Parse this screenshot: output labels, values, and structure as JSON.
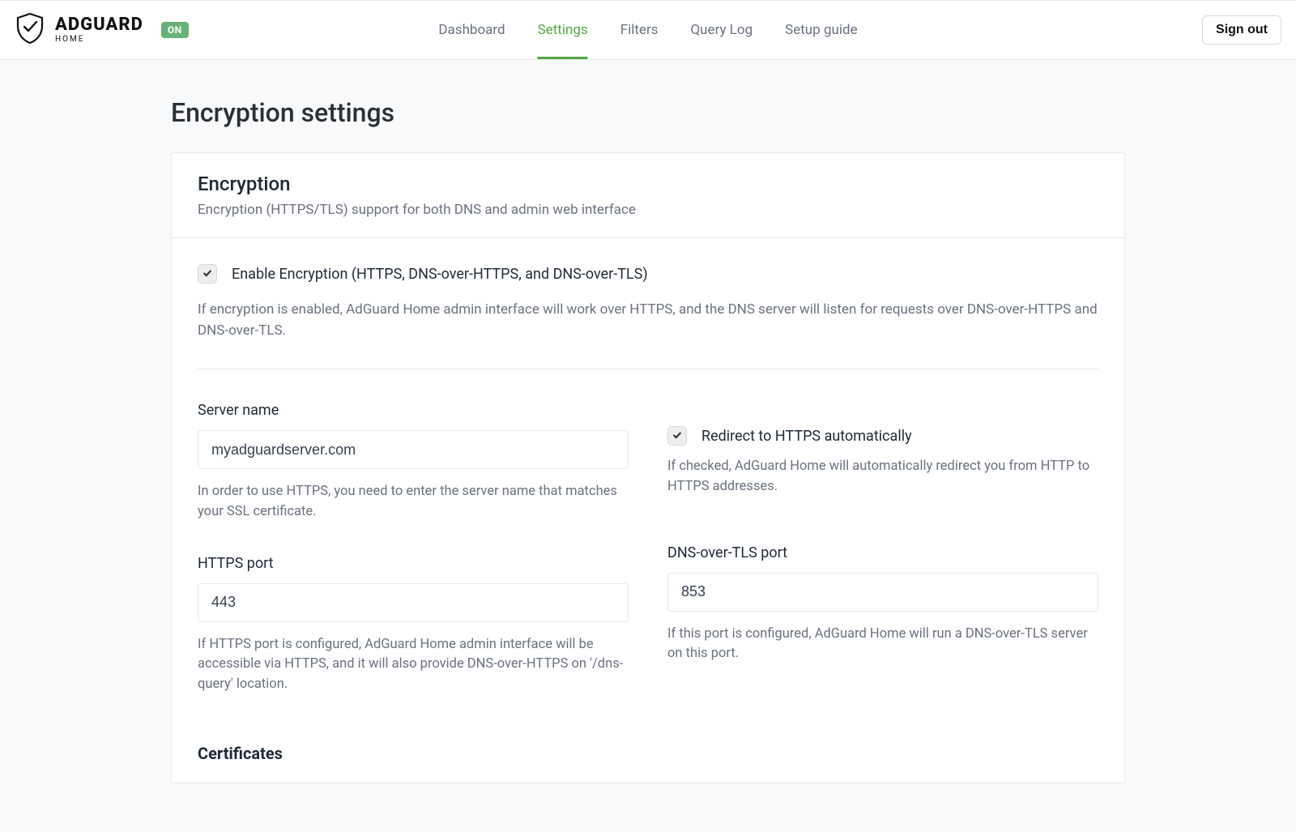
{
  "brand": {
    "name": "ADGUARD",
    "sub": "HOME",
    "status": "ON"
  },
  "nav": {
    "dashboard": "Dashboard",
    "settings": "Settings",
    "filters": "Filters",
    "querylog": "Query Log",
    "setupguide": "Setup guide"
  },
  "signout": "Sign out",
  "page": {
    "title": "Encryption settings"
  },
  "card": {
    "title": "Encryption",
    "subtitle": "Encryption (HTTPS/TLS) support for both DNS and admin web interface"
  },
  "enable": {
    "label": "Enable Encryption (HTTPS, DNS-over-HTTPS, and DNS-over-TLS)",
    "help": "If encryption is enabled, AdGuard Home admin interface will work over HTTPS, and the DNS server will listen for requests over DNS-over-HTTPS and DNS-over-TLS."
  },
  "server_name": {
    "label": "Server name",
    "value": "myadguardserver.com",
    "help": "In order to use HTTPS, you need to enter the server name that matches your SSL certificate."
  },
  "redirect": {
    "label": "Redirect to HTTPS automatically",
    "help": "If checked, AdGuard Home will automatically redirect you from HTTP to HTTPS addresses."
  },
  "https_port": {
    "label": "HTTPS port",
    "value": "443",
    "help": "If HTTPS port is configured, AdGuard Home admin interface will be accessible via HTTPS, and it will also provide DNS-over-HTTPS on '/dns-query' location."
  },
  "dot_port": {
    "label": "DNS-over-TLS port",
    "value": "853",
    "help": "If this port is configured, AdGuard Home will run a DNS-over-TLS server on this port."
  },
  "certificates": {
    "title": "Certificates"
  }
}
